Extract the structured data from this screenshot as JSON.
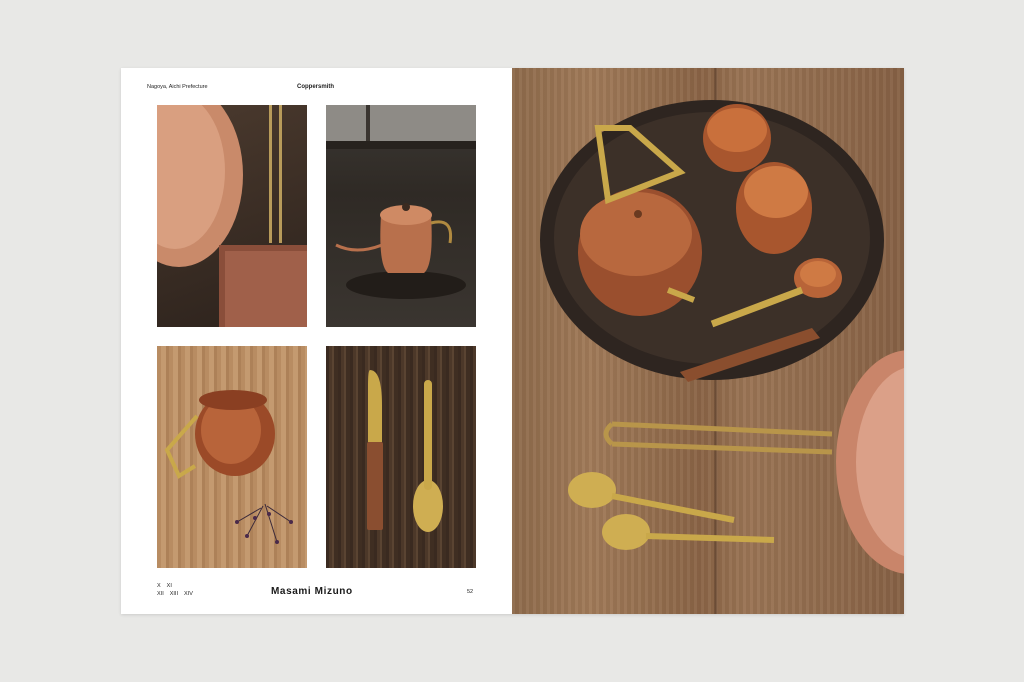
{
  "header": {
    "location": "Nagoya, Aichi Prefecture",
    "section": "Coppersmith"
  },
  "photos": [
    {
      "subject": "copper-pan-and-tray"
    },
    {
      "subject": "copper-drip-kettle"
    },
    {
      "subject": "copper-pot-on-wood"
    },
    {
      "subject": "brass-knife-and-spoon"
    }
  ],
  "footer": {
    "numerals_row1": [
      "X",
      "XI"
    ],
    "numerals_row2": [
      "XII",
      "XIII",
      "XIV"
    ],
    "name": "Masami Mizuno",
    "page": "52"
  },
  "colors": {
    "copper": "#b86a3c",
    "brass": "#c9a84a",
    "wood": "#96704f"
  }
}
